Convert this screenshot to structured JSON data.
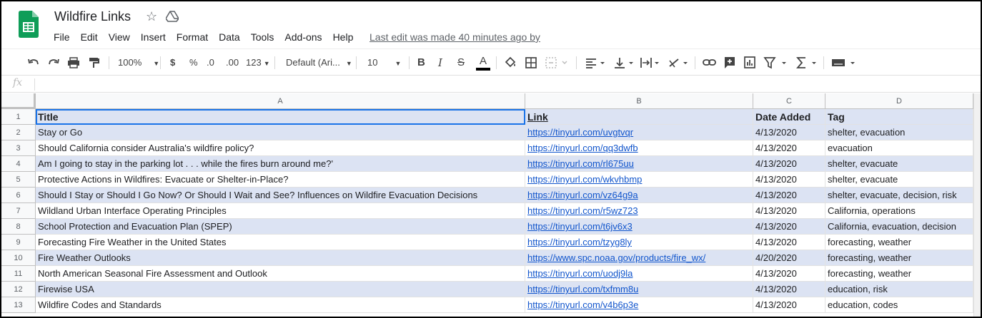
{
  "app": {
    "title": "Wildfire Links",
    "last_edit": "Last edit was made 40 minutes ago by"
  },
  "menu": [
    "File",
    "Edit",
    "View",
    "Insert",
    "Format",
    "Data",
    "Tools",
    "Add-ons",
    "Help"
  ],
  "toolbar": {
    "zoom": "100%",
    "currency": "$",
    "percent": "%",
    "dec_less": ".0",
    "dec_more": ".00",
    "format_more": "123",
    "font": "Default (Ari...",
    "font_size": "10",
    "bold": "B",
    "italic": "I",
    "strike": "S",
    "text_color": "A"
  },
  "formula_bar": {
    "fx": "fx"
  },
  "columns": [
    "A",
    "B",
    "C",
    "D"
  ],
  "rows": [
    {
      "n": "1",
      "a": "Title",
      "b": "Link",
      "c": "Date Added",
      "d": "Tag"
    },
    {
      "n": "2",
      "a": "Stay or Go",
      "b": "https://tinyurl.com/uvgtvqr",
      "c": "4/13/2020",
      "d": "shelter, evacuation"
    },
    {
      "n": "3",
      "a": "Should California consider Australia's wildfire policy?",
      "b": "https://tinyurl.com/qq3dwfb",
      "c": "4/13/2020",
      "d": "evacuation"
    },
    {
      "n": "4",
      "a": "Am I going to stay in the parking lot . . . while the fires burn around me?'",
      "b": "https://tinyurl.com/rl675uu",
      "c": "4/13/2020",
      "d": "shelter, evacuate"
    },
    {
      "n": "5",
      "a": "Protective Actions in Wildfires: Evacuate or Shelter-in-Place?",
      "b": "https://tinyurl.com/wkvhbmp",
      "c": "4/13/2020",
      "d": "shelter, evacuate"
    },
    {
      "n": "6",
      "a": "Should I Stay or Should I Go Now? Or Should I Wait and See? Influences on Wildfire Evacuation Decisions",
      "b": "https://tinyurl.com/vz64g9a",
      "c": "4/13/2020",
      "d": "shelter, evacuate, decision, risk"
    },
    {
      "n": "7",
      "a": "Wildland Urban Interface Operating Principles",
      "b": "https://tinyurl.com/r5wz723",
      "c": "4/13/2020",
      "d": "California, operations"
    },
    {
      "n": "8",
      "a": "School Protection and Evacuation Plan (SPEP)",
      "b": "https://tinyurl.com/t6jv6x3",
      "c": "4/13/2020",
      "d": "California, evacuation, decision"
    },
    {
      "n": "9",
      "a": "Forecasting Fire Weather in the United States",
      "b": "https://tinyurl.com/tzyg8ly",
      "c": "4/13/2020",
      "d": "forecasting, weather"
    },
    {
      "n": "10",
      "a": "Fire Weather Outlooks",
      "b": "https://www.spc.noaa.gov/products/fire_wx/",
      "c": "4/20/2020",
      "d": "forecasting, weather"
    },
    {
      "n": "11",
      "a": "North American Seasonal Fire Assessment and Outlook",
      "b": "https://tinyurl.com/uodj9la",
      "c": "4/13/2020",
      "d": "forecasting, weather"
    },
    {
      "n": "12",
      "a": "Firewise USA",
      "b": "https://tinyurl.com/txfmm8u",
      "c": "4/13/2020",
      "d": "education, risk"
    },
    {
      "n": "13",
      "a": "Wildfire Codes and Standards",
      "b": "https://tinyurl.com/v4b6p3e",
      "c": "4/13/2020",
      "d": "education, codes"
    }
  ],
  "colors": {
    "band": "#dce3f3",
    "link": "#1155cc",
    "selection": "#1a73e8",
    "logo": "#0f9d58"
  }
}
